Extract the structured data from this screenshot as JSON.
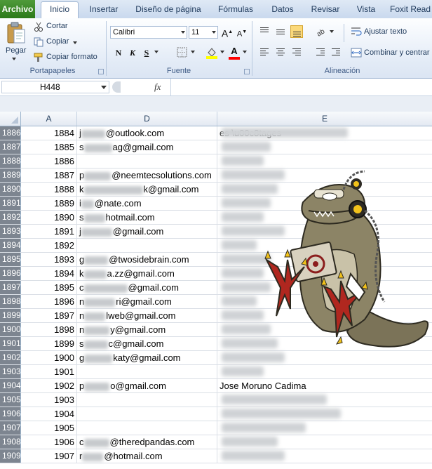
{
  "ribbon": {
    "tabs": [
      "Archivo",
      "Inicio",
      "Insertar",
      "Diseño de página",
      "Fórmulas",
      "Datos",
      "Revisar",
      "Vista",
      "Foxit Read"
    ],
    "clipboard": {
      "paste": "Pegar",
      "cut": "Cortar",
      "copy": "Copiar",
      "format_painter": "Copiar formato",
      "label": "Portapapeles"
    },
    "font": {
      "name": "Calibri",
      "size": "11",
      "label": "Fuente",
      "bold": "N",
      "italic": "K",
      "underline": "S",
      "fill_color": "#ffff00",
      "font_color": "#ff0000"
    },
    "alignment": {
      "wrap_text": "Ajustar texto",
      "merge_center": "Combinar y centrar",
      "label": "Alineación"
    }
  },
  "formula_bar": {
    "name_box": "H448",
    "fx": "fx",
    "content": ""
  },
  "columns": [
    "A",
    "D",
    "E"
  ],
  "rows": [
    {
      "row": "1886",
      "a": "1884",
      "d_prefix": "j",
      "d": "@outlook.com",
      "e": "es \\u00c8tages"
    },
    {
      "row": "1887",
      "a": "1885",
      "d_prefix": "s",
      "d": "ag@gmail.com",
      "e": ""
    },
    {
      "row": "1888",
      "a": "1886",
      "d_prefix": "",
      "d": "",
      "e": ""
    },
    {
      "row": "1889",
      "a": "1887",
      "d_prefix": "p",
      "d": "@neemtecsolutions.com",
      "e": ""
    },
    {
      "row": "1890",
      "a": "1888",
      "d_prefix": "k",
      "d": "k@gmail.com",
      "e": ""
    },
    {
      "row": "1891",
      "a": "1889",
      "d_prefix": "i",
      "d": "@nate.com",
      "e": ""
    },
    {
      "row": "1892",
      "a": "1890",
      "d_prefix": "s",
      "d": "hotmail.com",
      "e": ""
    },
    {
      "row": "1893",
      "a": "1891",
      "d_prefix": "j",
      "d": "@gmail.com",
      "e": ""
    },
    {
      "row": "1894",
      "a": "1892",
      "d_prefix": "",
      "d": "",
      "e": ""
    },
    {
      "row": "1895",
      "a": "1893",
      "d_prefix": "g",
      "d": "@twosidebrain.com",
      "e": ""
    },
    {
      "row": "1896",
      "a": "1894",
      "d_prefix": "k",
      "d": "a.zz@gmail.com",
      "e": ""
    },
    {
      "row": "1897",
      "a": "1895",
      "d_prefix": "c",
      "d": "@gmail.com",
      "e": ""
    },
    {
      "row": "1898",
      "a": "1896",
      "d_prefix": "n",
      "d": "ri@gmail.com",
      "e": ""
    },
    {
      "row": "1899",
      "a": "1897",
      "d_prefix": "n",
      "d": "lweb@gmail.com",
      "e": ""
    },
    {
      "row": "1900",
      "a": "1898",
      "d_prefix": "n",
      "d": "y@gmail.com",
      "e": ""
    },
    {
      "row": "1901",
      "a": "1899",
      "d_prefix": "s",
      "d": "c@gmail.com",
      "e": ""
    },
    {
      "row": "1902",
      "a": "1900",
      "d_prefix": "g",
      "d": "katy@gmail.com",
      "e": ""
    },
    {
      "row": "1903",
      "a": "1901",
      "d_prefix": "",
      "d": "",
      "e": ""
    },
    {
      "row": "1904",
      "a": "1902",
      "d_prefix": "p",
      "d": "o@gmail.com",
      "e": "Jose Moruno Cadima"
    },
    {
      "row": "1905",
      "a": "1903",
      "d_prefix": "",
      "d": "",
      "e": ""
    },
    {
      "row": "1906",
      "a": "1904",
      "d_prefix": "",
      "d": "",
      "e": ""
    },
    {
      "row": "1907",
      "a": "1905",
      "d_prefix": "",
      "d": "",
      "e": ""
    },
    {
      "row": "1908",
      "a": "1906",
      "d_prefix": "c",
      "d": "@theredpandas.com",
      "e": ""
    },
    {
      "row": "1909",
      "a": "1907",
      "d_prefix": "r",
      "d": "@hotmail.com",
      "e": ""
    }
  ]
}
